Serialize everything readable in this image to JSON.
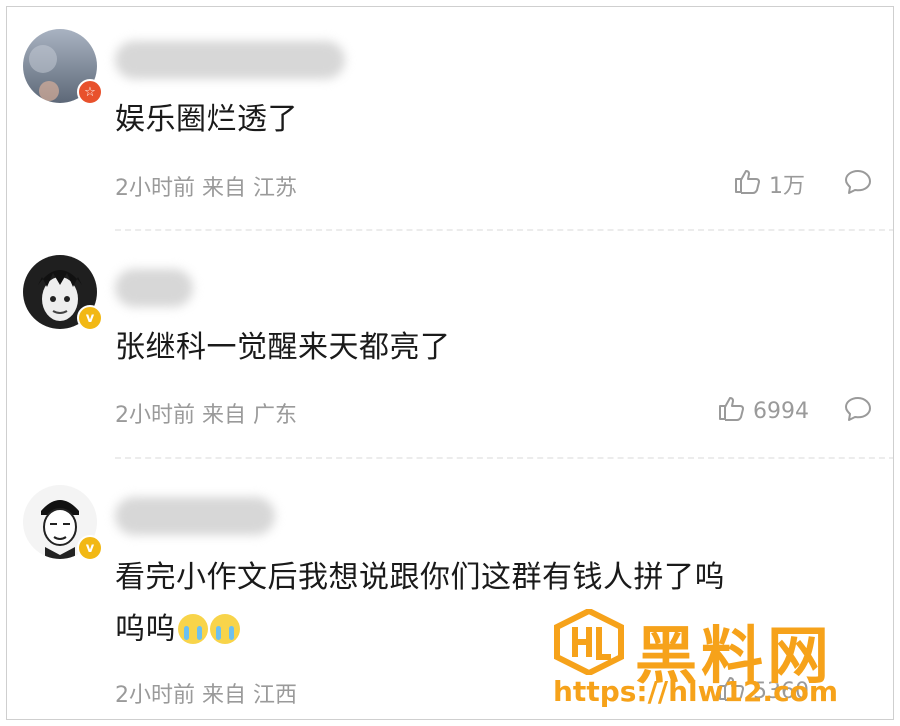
{
  "comments": [
    {
      "text": "娱乐圈烂透了",
      "meta": "2小时前 来自 江苏",
      "likes": "1万",
      "badge": "☆"
    },
    {
      "text": "张继科一觉醒来天都亮了",
      "meta": "2小时前 来自 广东",
      "likes": "6994",
      "badge": "v"
    },
    {
      "text_line1": "看完小作文后我想说跟你们这群有钱人拼了呜",
      "text_line2": "呜呜",
      "meta": "2小时前 来自 江西",
      "likes": "5360",
      "badge": "v"
    }
  ],
  "watermark": {
    "title": "黑料网",
    "url": "https://hlw12.com"
  },
  "colors": {
    "accent_orange": "#f6a21a",
    "badge_red": "#e8512c",
    "badge_gold": "#f2b814",
    "meta_gray": "#9a9a9a"
  }
}
